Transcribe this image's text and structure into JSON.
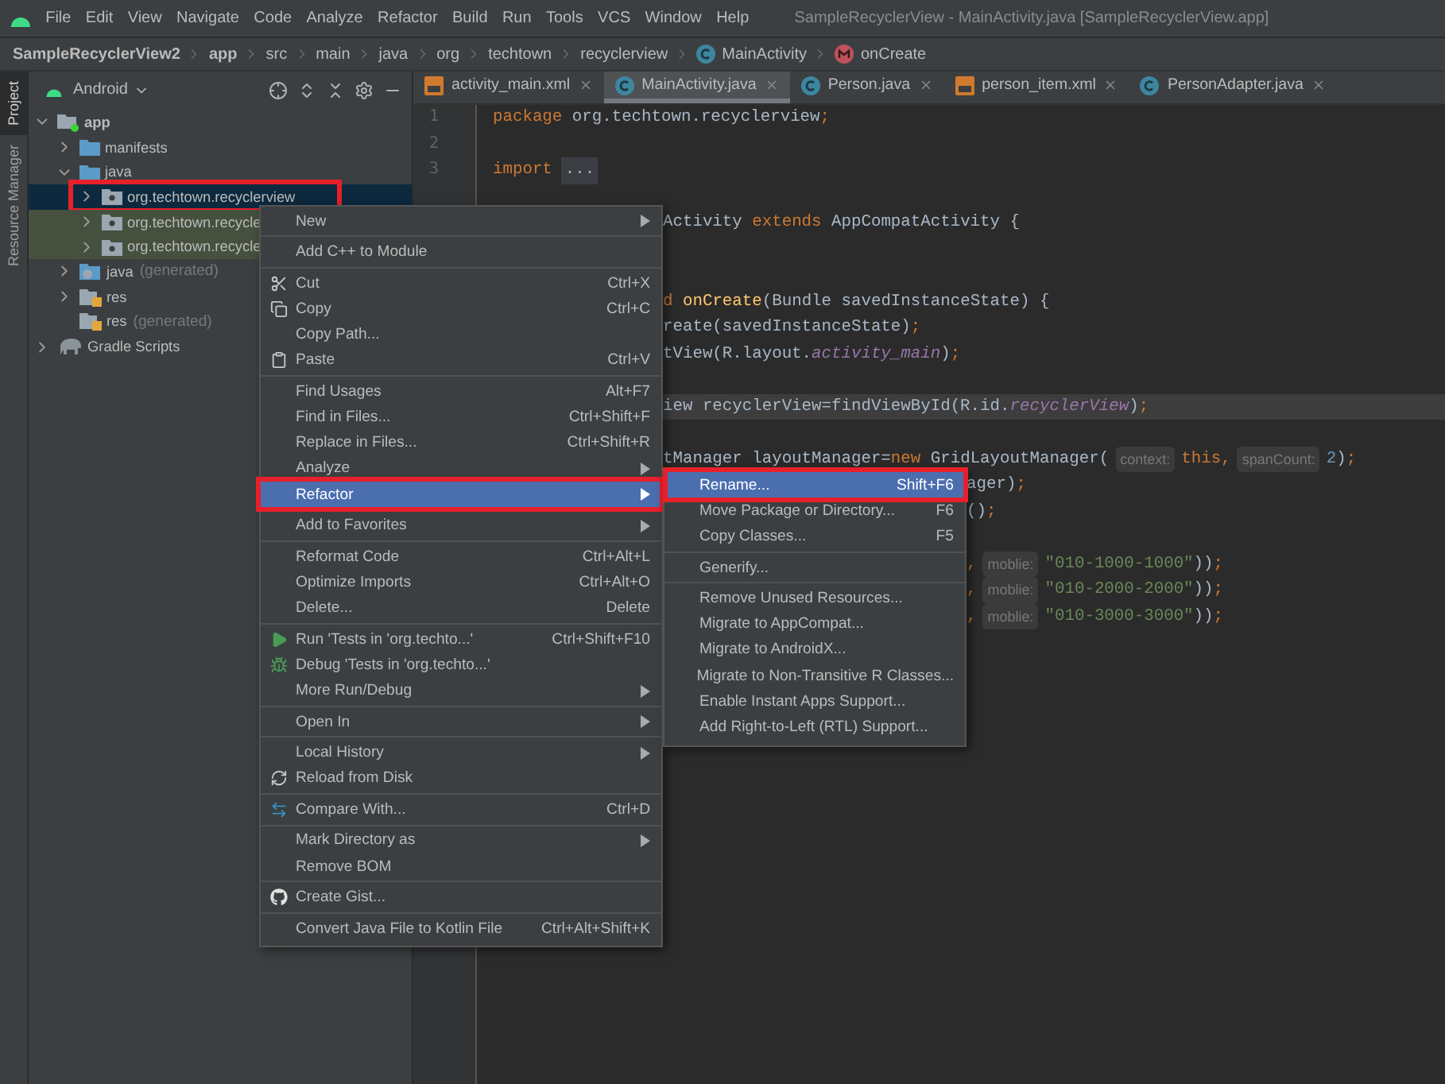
{
  "menu_bar": {
    "items": [
      "File",
      "Edit",
      "View",
      "Navigate",
      "Code",
      "Analyze",
      "Refactor",
      "Build",
      "Run",
      "Tools",
      "VCS",
      "Window",
      "Help"
    ],
    "title": "SampleRecyclerView - MainActivity.java [SampleRecyclerView.app]"
  },
  "breadcrumb": [
    {
      "label": "SampleRecyclerView2",
      "bold": true,
      "kind": "plain"
    },
    {
      "label": "app",
      "bold": true,
      "kind": "plain"
    },
    {
      "label": "src",
      "bold": false,
      "kind": "plain"
    },
    {
      "label": "main",
      "bold": false,
      "kind": "plain"
    },
    {
      "label": "java",
      "bold": false,
      "kind": "plain"
    },
    {
      "label": "org",
      "bold": false,
      "kind": "plain"
    },
    {
      "label": "techtown",
      "bold": false,
      "kind": "plain"
    },
    {
      "label": "recyclerview",
      "bold": false,
      "kind": "plain"
    },
    {
      "label": "MainActivity",
      "bold": false,
      "kind": "class"
    },
    {
      "label": "onCreate",
      "bold": false,
      "kind": "method"
    }
  ],
  "tool_strip": [
    {
      "label": "Project",
      "selected": true
    },
    {
      "label": "Resource Manager",
      "selected": false
    }
  ],
  "project_panel": {
    "view": "Android",
    "tree": [
      {
        "label": "app",
        "kind": "module",
        "expanded": true,
        "selected": false,
        "tinted": false,
        "children": [
          {
            "label": "manifests",
            "kind": "folder",
            "expanded": false,
            "selected": false,
            "tinted": false
          },
          {
            "label": "java",
            "kind": "folder",
            "expanded": true,
            "selected": false,
            "tinted": false,
            "children": [
              {
                "label": "org.techtown.recyclerview",
                "kind": "package",
                "expanded": false,
                "selected": true,
                "tinted": false,
                "annotated": true
              },
              {
                "label": "org.techtown.recycle",
                "kind": "package",
                "expanded": false,
                "selected": false,
                "tinted": true,
                "annotated": false
              },
              {
                "label": "org.techtown.recycle",
                "kind": "package",
                "expanded": false,
                "selected": false,
                "tinted": true,
                "annotated": false
              }
            ]
          },
          {
            "label": "java",
            "suffix": "(generated)",
            "kind": "generated",
            "expanded": false,
            "selected": false,
            "tinted": false
          },
          {
            "label": "res",
            "kind": "resources",
            "expanded": false,
            "selected": false,
            "tinted": false
          },
          {
            "label": "res",
            "suffix": "(generated)",
            "kind": "resources",
            "selected": false,
            "tinted": false
          }
        ]
      },
      {
        "label": "Gradle Scripts",
        "kind": "gradle",
        "expanded": false,
        "selected": false,
        "tinted": false
      }
    ]
  },
  "tabs": [
    {
      "label": "activity_main.xml",
      "kind": "xml",
      "selected": false
    },
    {
      "label": "MainActivity.java",
      "kind": "class",
      "selected": true
    },
    {
      "label": "Person.java",
      "kind": "class",
      "selected": false
    },
    {
      "label": "person_item.xml",
      "kind": "xml",
      "selected": false
    },
    {
      "label": "PersonAdapter.java",
      "kind": "class",
      "selected": false
    }
  ],
  "code": [
    {
      "number": "1",
      "kind": "full",
      "segments": [
        {
          "text": "package",
          "kind": "kw"
        },
        {
          "text": " org.techtown.recyclerview",
          "kind": "plain"
        },
        {
          "text": ";",
          "kind": "kw"
        }
      ]
    },
    {
      "number": "2",
      "kind": "blank"
    },
    {
      "number": "3",
      "kind": "full",
      "segments": [
        {
          "text": "import",
          "kind": "kw"
        },
        {
          "text": "...",
          "kind": "fold"
        }
      ]
    },
    {
      "kind": "blank"
    },
    {
      "kind": "behind-menu",
      "segments": [
        {
          "text": "Activity ",
          "kind": "plain"
        },
        {
          "text": "extends",
          "kind": "kw"
        },
        {
          "text": " AppCompatActivity {",
          "kind": "plain"
        }
      ]
    },
    {
      "kind": "blank"
    },
    {
      "kind": "blank"
    },
    {
      "kind": "behind-menu",
      "segments": [
        {
          "text": "d ",
          "kind": "kw"
        },
        {
          "text": "onCreate",
          "kind": "method"
        },
        {
          "text": "(Bundle savedInstanceState) {",
          "kind": "plain"
        }
      ]
    },
    {
      "kind": "behind-menu",
      "segments": [
        {
          "text": "reate(savedInstanceState)",
          "kind": "plain"
        },
        {
          "text": ";",
          "kind": "kw"
        }
      ]
    },
    {
      "kind": "behind-menu",
      "segments": [
        {
          "text": "tView(R.layout.",
          "kind": "plain"
        },
        {
          "text": "activity_main",
          "kind": "field"
        },
        {
          "text": ")",
          "kind": "plain"
        },
        {
          "text": ";",
          "kind": "kw"
        }
      ]
    },
    {
      "kind": "blank"
    },
    {
      "kind": "behind-menu",
      "current": true,
      "segments": [
        {
          "text": "iew recyclerView=findViewById(R.id.",
          "kind": "plain"
        },
        {
          "text": "recyclerView",
          "kind": "field"
        },
        {
          "text": ")",
          "kind": "plain"
        },
        {
          "text": ";",
          "kind": "kw"
        }
      ]
    },
    {
      "kind": "blank"
    },
    {
      "kind": "behind-menu",
      "segments": [
        {
          "text": "tManager layoutManager=",
          "kind": "plain"
        },
        {
          "text": "new",
          "kind": "kw"
        },
        {
          "text": " GridLayoutManager(",
          "kind": "plain"
        },
        {
          "text": "context:",
          "kind": "hint"
        },
        {
          "text": "this,",
          "kind": "kw"
        },
        {
          "text": "spanCount:",
          "kind": "hint"
        },
        {
          "text": "2",
          "kind": "num"
        },
        {
          "text": ")",
          "kind": "plain"
        },
        {
          "text": ";",
          "kind": "kw"
        }
      ]
    },
    {
      "kind": "behind-submenu",
      "segments": [
        {
          "text": "ager)",
          "kind": "plain"
        },
        {
          "text": ";",
          "kind": "kw"
        }
      ]
    },
    {
      "kind": "behind-submenu",
      "segments": [
        {
          "text": "()",
          "kind": "plain"
        },
        {
          "text": ";",
          "kind": "kw"
        }
      ]
    },
    {
      "kind": "blank"
    },
    {
      "kind": "behind-submenu",
      "segments": [
        {
          "text": ",",
          "kind": "kw"
        },
        {
          "text": "moblie:",
          "kind": "hint"
        },
        {
          "text": "\"010-1000-1000\"",
          "kind": "str"
        },
        {
          "text": "))",
          "kind": "plain"
        },
        {
          "text": ";",
          "kind": "kw"
        }
      ]
    },
    {
      "kind": "behind-submenu",
      "segments": [
        {
          "text": ",",
          "kind": "kw"
        },
        {
          "text": "moblie:",
          "kind": "hint"
        },
        {
          "text": "\"010-2000-2000\"",
          "kind": "str"
        },
        {
          "text": "))",
          "kind": "plain"
        },
        {
          "text": ";",
          "kind": "kw"
        }
      ]
    },
    {
      "kind": "behind-submenu",
      "segments": [
        {
          "text": ",",
          "kind": "kw"
        },
        {
          "text": "moblie:",
          "kind": "hint"
        },
        {
          "text": "\"010-3000-3000\"",
          "kind": "str"
        },
        {
          "text": "))",
          "kind": "plain"
        },
        {
          "text": ";",
          "kind": "kw"
        }
      ]
    }
  ],
  "context_menu": {
    "groups": [
      [
        {
          "label": "New",
          "submenu": true,
          "selected": false
        }
      ],
      [
        {
          "label": "Add C++ to Module",
          "selected": false
        }
      ],
      [
        {
          "label": "Cut",
          "shortcut": "Ctrl+X",
          "kind": "cut",
          "selected": false
        },
        {
          "label": "Copy",
          "shortcut": "Ctrl+C",
          "kind": "copy",
          "selected": false
        },
        {
          "label": "Copy Path...",
          "selected": false
        },
        {
          "label": "Paste",
          "shortcut": "Ctrl+V",
          "kind": "paste",
          "selected": false
        }
      ],
      [
        {
          "label": "Find Usages",
          "shortcut": "Alt+F7",
          "selected": false
        },
        {
          "label": "Find in Files...",
          "shortcut": "Ctrl+Shift+F",
          "selected": false
        },
        {
          "label": "Replace in Files...",
          "shortcut": "Ctrl+Shift+R",
          "selected": false
        },
        {
          "label": "Analyze",
          "submenu": true,
          "selected": false
        },
        {
          "label": "Refactor",
          "submenu": true,
          "selected": true,
          "annotated": true
        }
      ],
      [
        {
          "label": "Add to Favorites",
          "submenu": true,
          "selected": false
        }
      ],
      [
        {
          "label": "Reformat Code",
          "shortcut": "Ctrl+Alt+L",
          "selected": false
        },
        {
          "label": "Optimize Imports",
          "shortcut": "Ctrl+Alt+O",
          "selected": false
        },
        {
          "label": "Delete...",
          "shortcut": "Delete",
          "selected": false
        }
      ],
      [
        {
          "label": "Run 'Tests in 'org.techto...'",
          "shortcut": "Ctrl+Shift+F10",
          "kind": "run",
          "selected": false
        },
        {
          "label": "Debug 'Tests in 'org.techto...'",
          "kind": "debug",
          "selected": false
        },
        {
          "label": "More Run/Debug",
          "submenu": true,
          "selected": false
        }
      ],
      [
        {
          "label": "Open In",
          "submenu": true,
          "selected": false
        }
      ],
      [
        {
          "label": "Local History",
          "submenu": true,
          "selected": false
        },
        {
          "label": "Reload from Disk",
          "kind": "reload",
          "selected": false
        }
      ],
      [
        {
          "label": "Compare With...",
          "shortcut": "Ctrl+D",
          "kind": "compare",
          "selected": false
        }
      ],
      [
        {
          "label": "Mark Directory as",
          "submenu": true,
          "selected": false
        },
        {
          "label": "Remove BOM",
          "selected": false
        }
      ],
      [
        {
          "label": "Create Gist...",
          "kind": "gist",
          "selected": false
        }
      ],
      [
        {
          "label": "Convert Java File to Kotlin File",
          "shortcut": "Ctrl+Alt+Shift+K",
          "selected": false
        }
      ]
    ]
  },
  "refactor_submenu": {
    "groups": [
      [
        {
          "label": "Rename...",
          "shortcut": "Shift+F6",
          "selected": true,
          "annotated": true
        },
        {
          "label": "Move Package or Directory...",
          "shortcut": "F6",
          "selected": false
        },
        {
          "label": "Copy Classes...",
          "shortcut": "F5",
          "selected": false
        }
      ],
      [
        {
          "label": "Generify...",
          "selected": false
        }
      ],
      [
        {
          "label": "Remove Unused Resources...",
          "selected": false
        },
        {
          "label": "Migrate to AppCompat...",
          "selected": false
        },
        {
          "label": "Migrate to AndroidX...",
          "selected": false
        },
        {
          "label": "Migrate to Non-Transitive R Classes...",
          "selected": false
        },
        {
          "label": "Enable Instant Apps Support...",
          "selected": false
        },
        {
          "label": "Add Right-to-Left (RTL) Support...",
          "selected": false
        }
      ]
    ]
  }
}
